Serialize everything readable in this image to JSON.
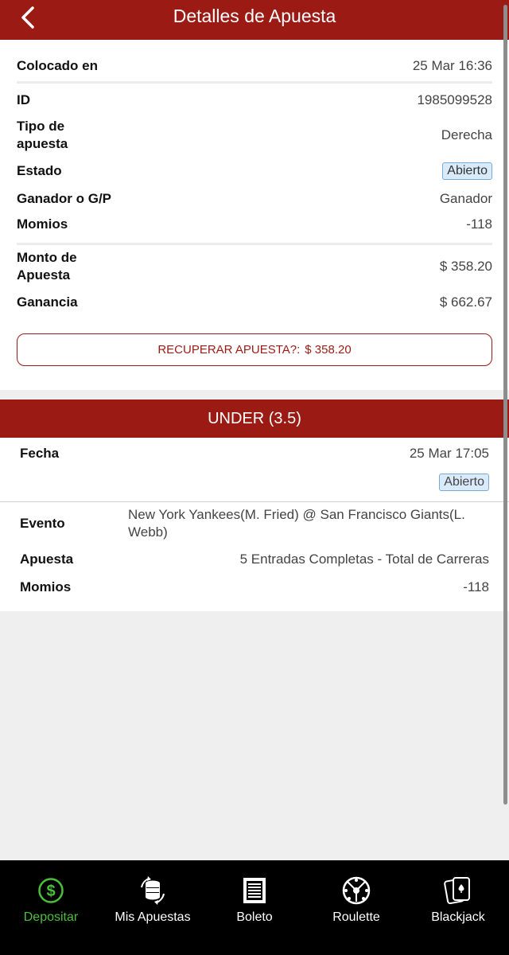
{
  "header": {
    "title": "Detalles de Apuesta",
    "back_icon": "chevron-left-icon"
  },
  "bet": {
    "placed_label": "Colocado en",
    "placed_value": "25 Mar 16:36",
    "id_label": "ID",
    "id_value": "1985099528",
    "type_label": "Tipo de apuesta",
    "type_value": "Derecha",
    "status_label": "Estado",
    "status_value": "Abierto",
    "result_label": "Ganador o G/P",
    "result_value": "Ganador",
    "odds_label": "Momios",
    "odds_value": "-118",
    "amount_label": "Monto de Apuesta",
    "amount_value": "$ 358.20",
    "profit_label": "Ganancia",
    "profit_value": "$ 662.67"
  },
  "recover": {
    "label": "RECUPERAR APUESTA?:",
    "amount": "$ 358.20"
  },
  "selection": {
    "title": "UNDER (3.5)",
    "date_label": "Fecha",
    "date_value": "25 Mar 17:05",
    "status_value": "Abierto",
    "event_label": "Evento",
    "event_value": "New York Yankees(M. Fried) @ San Francisco Giants(L. Webb)",
    "bet_label": "Apuesta",
    "bet_value": "5 Entradas Completas - Total de Carreras",
    "odds_label": "Momios",
    "odds_value": "-118"
  },
  "tabs": [
    {
      "label": "Depositar",
      "icon": "dollar-icon",
      "active": true
    },
    {
      "label": "Mis Apuestas",
      "icon": "coins-icon",
      "active": false
    },
    {
      "label": "Boleto",
      "icon": "ticket-icon",
      "active": false
    },
    {
      "label": "Roulette",
      "icon": "roulette-icon",
      "active": false
    },
    {
      "label": "Blackjack",
      "icon": "cards-icon",
      "active": false
    }
  ],
  "colors": {
    "brand": "#9b1b14",
    "active_tab": "#4bbf3a",
    "badge_bg": "#d9eafa",
    "badge_border": "#7aa9d6"
  }
}
